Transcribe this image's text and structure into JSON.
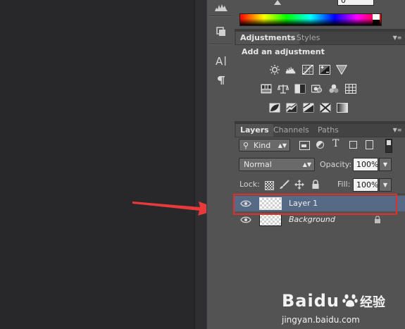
{
  "adjustments_panel": {
    "tabs": [
      {
        "label": "Adjustments",
        "active": true
      },
      {
        "label": "Styles",
        "active": false
      }
    ],
    "heading": "Add an adjustment",
    "icons": [
      "brightness-contrast-icon",
      "levels-icon",
      "curves-icon",
      "exposure-icon",
      "vibrance-icon",
      "hue-saturation-icon",
      "color-balance-icon",
      "black-white-icon",
      "photo-filter-icon",
      "channel-mixer-icon",
      "color-lookup-icon",
      "invert-icon",
      "posterize-icon",
      "threshold-icon",
      "selective-color-icon",
      "gradient-map-icon"
    ]
  },
  "color_panel": {
    "value": "0"
  },
  "layers_panel": {
    "tabs": [
      {
        "label": "Layers",
        "active": true
      },
      {
        "label": "Channels",
        "active": false
      },
      {
        "label": "Paths",
        "active": false
      }
    ],
    "filter_kind": "Kind",
    "blend_mode": "Normal",
    "opacity_label": "Opacity:",
    "opacity_value": "100%",
    "lock_label": "Lock:",
    "fill_label": "Fill:",
    "fill_value": "100%",
    "layers": [
      {
        "name": "Layer 1",
        "selected": true,
        "locked": false
      },
      {
        "name": "Background",
        "selected": false,
        "locked": true
      }
    ]
  },
  "annotation": {
    "arrow_color": "#e83a3a",
    "highlight_color": "#e0302c"
  },
  "watermark": {
    "brand": "Baidu",
    "brand_suffix": "经验",
    "url": "jingyan.baidu.com"
  }
}
